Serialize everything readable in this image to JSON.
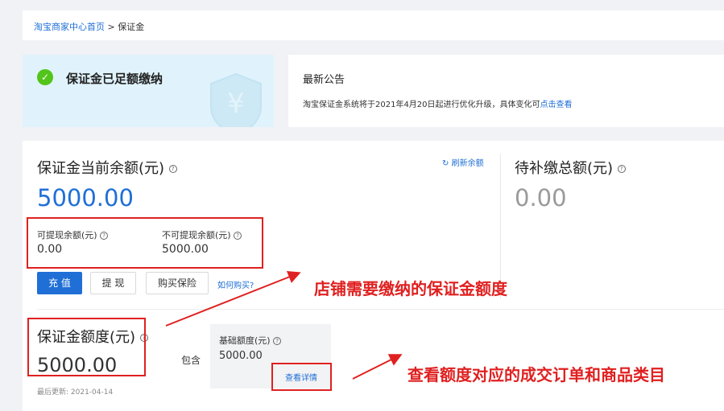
{
  "breadcrumb": {
    "home": "淘宝商家中心首页",
    "sep": " > ",
    "current": "保证金"
  },
  "status": {
    "text": "保证金已足额缴纳"
  },
  "notice": {
    "title": "最新公告",
    "text": "淘宝保证金系统将于2021年4月20日起进行优化升级，具体变化可",
    "link": "点击查看"
  },
  "balance": {
    "title": "保证金当前余额(元)",
    "refresh": "刷新余额",
    "amount": "5000.00",
    "withdrawable_label": "可提现余额(元)",
    "withdrawable_value": "0.00",
    "non_withdrawable_label": "不可提现余额(元)",
    "non_withdrawable_value": "5000.00"
  },
  "buttons": {
    "recharge": "充 值",
    "withdraw": "提 现",
    "buy_insurance": "购买保险",
    "how_buy": "如何购买?"
  },
  "pending": {
    "title": "待补缴总额(元)",
    "amount": "0.00"
  },
  "quota": {
    "title": "保证金额度(元)",
    "amount": "5000.00",
    "includes": "包含",
    "base_label": "基础额度(元)",
    "base_value": "5000.00",
    "detail_link": "查看详情",
    "updated": "最后更新:  2021-04-14"
  },
  "annotations": {
    "a1": "店铺需要缴纳的保证金额度",
    "a2": "查看额度对应的成交订单和商品类目"
  },
  "colors": {
    "accent": "#1f6fd6",
    "success": "#52c41a",
    "annotation": "#e02020"
  }
}
